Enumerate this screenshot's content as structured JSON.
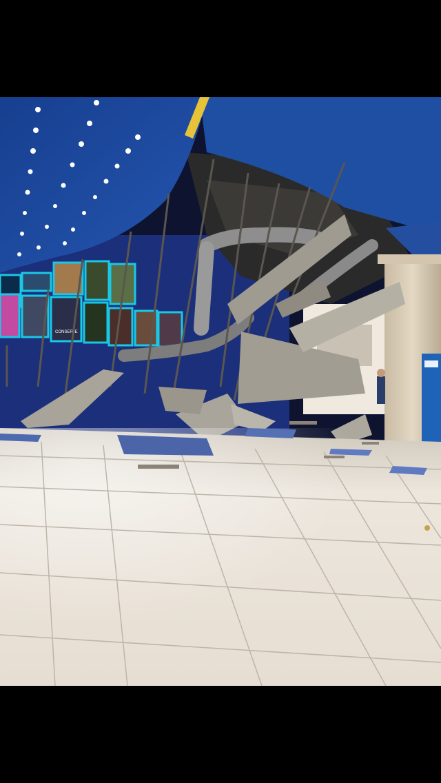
{
  "photo": {
    "subject": "collapsed-ceiling-cinema-lobby",
    "poster_captions": [
      "CONSERJE"
    ],
    "colors": {
      "letterbox": "#000000",
      "ceiling_blue": "#1f4fa3",
      "wall_blue": "#1c2f7a",
      "floor": "#e9e2d8",
      "poster_frame": "#19c8e6",
      "debris": "#a8a49a",
      "duct": "#8e8e8e",
      "column": "#d9ccb6"
    }
  }
}
